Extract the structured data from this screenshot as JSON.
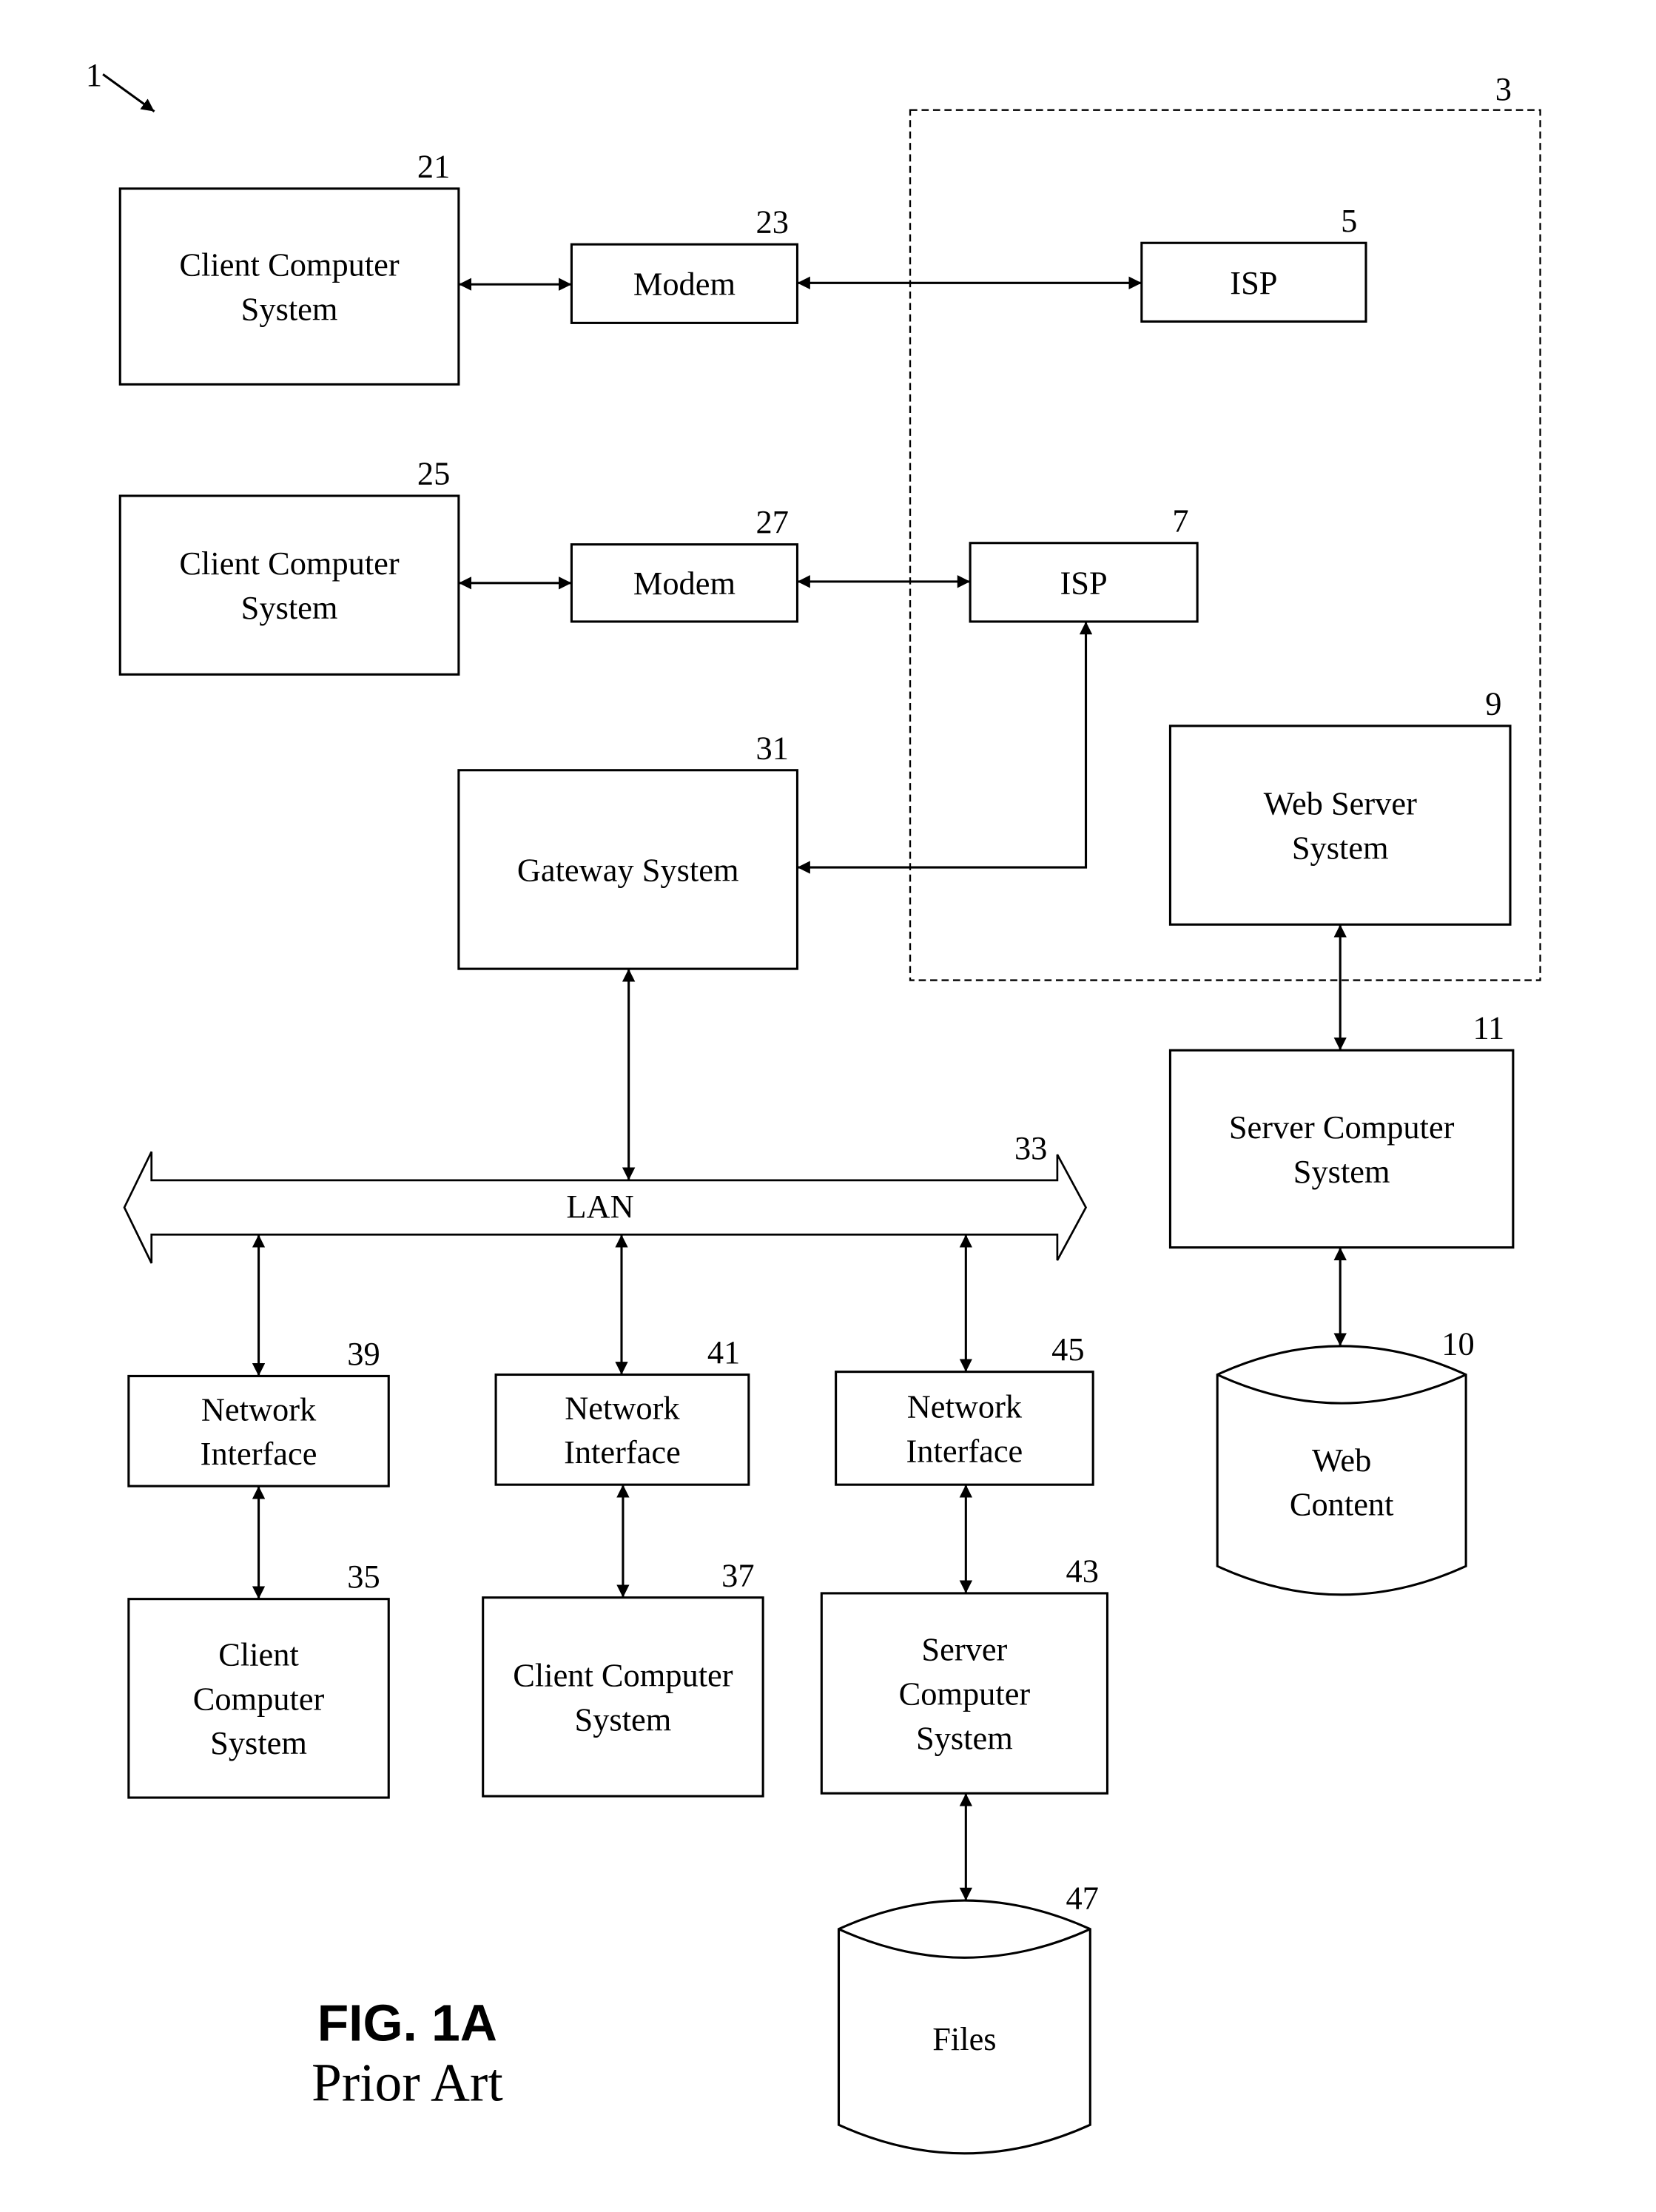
{
  "figure": {
    "ref": "1",
    "caption_title": "FIG. 1A",
    "caption_subtitle": "Prior Art"
  },
  "internet_region": {
    "ref": "3"
  },
  "nodes": {
    "client21": {
      "ref": "21",
      "lines": [
        "Client Computer",
        "System"
      ]
    },
    "modem23": {
      "ref": "23",
      "lines": [
        "Modem"
      ]
    },
    "isp5": {
      "ref": "5",
      "lines": [
        "ISP"
      ]
    },
    "client25": {
      "ref": "25",
      "lines": [
        "Client Computer",
        "System"
      ]
    },
    "modem27": {
      "ref": "27",
      "lines": [
        "Modem"
      ]
    },
    "isp7": {
      "ref": "7",
      "lines": [
        "ISP"
      ]
    },
    "gateway31": {
      "ref": "31",
      "lines": [
        "Gateway System"
      ]
    },
    "webserver9": {
      "ref": "9",
      "lines": [
        "Web Server",
        "System"
      ]
    },
    "server11": {
      "ref": "11",
      "lines": [
        "Server Computer",
        "System"
      ]
    },
    "webcontent10": {
      "ref": "10",
      "lines": [
        "Web",
        "Content"
      ]
    },
    "lan33": {
      "ref": "33",
      "lines": [
        "LAN"
      ]
    },
    "netif39": {
      "ref": "39",
      "lines": [
        "Network",
        "Interface"
      ]
    },
    "netif41": {
      "ref": "41",
      "lines": [
        "Network",
        "Interface"
      ]
    },
    "netif45": {
      "ref": "45",
      "lines": [
        "Network",
        "Interface"
      ]
    },
    "client35": {
      "ref": "35",
      "lines": [
        "Client",
        "Computer",
        "System"
      ]
    },
    "client37": {
      "ref": "37",
      "lines": [
        "Client Computer",
        "System"
      ]
    },
    "server43": {
      "ref": "43",
      "lines": [
        "Server",
        "Computer",
        "System"
      ]
    },
    "files47": {
      "ref": "47",
      "lines": [
        "Files"
      ]
    }
  },
  "connections": [
    {
      "from": "client21",
      "to": "modem23",
      "direction": "bidirectional"
    },
    {
      "from": "modem23",
      "to": "isp5",
      "direction": "bidirectional"
    },
    {
      "from": "client25",
      "to": "modem27",
      "direction": "bidirectional"
    },
    {
      "from": "modem27",
      "to": "isp7",
      "direction": "bidirectional"
    },
    {
      "from": "gateway31",
      "to": "isp7",
      "direction": "bidirectional"
    },
    {
      "from": "gateway31",
      "to": "lan33",
      "direction": "bidirectional"
    },
    {
      "from": "webserver9",
      "to": "server11",
      "direction": "bidirectional"
    },
    {
      "from": "server11",
      "to": "webcontent10",
      "direction": "bidirectional"
    },
    {
      "from": "lan33",
      "to": "netif39",
      "direction": "bidirectional"
    },
    {
      "from": "lan33",
      "to": "netif41",
      "direction": "bidirectional"
    },
    {
      "from": "lan33",
      "to": "netif45",
      "direction": "bidirectional"
    },
    {
      "from": "netif39",
      "to": "client35",
      "direction": "bidirectional"
    },
    {
      "from": "netif41",
      "to": "client37",
      "direction": "bidirectional"
    },
    {
      "from": "netif45",
      "to": "server43",
      "direction": "bidirectional"
    },
    {
      "from": "server43",
      "to": "files47",
      "direction": "bidirectional"
    }
  ]
}
